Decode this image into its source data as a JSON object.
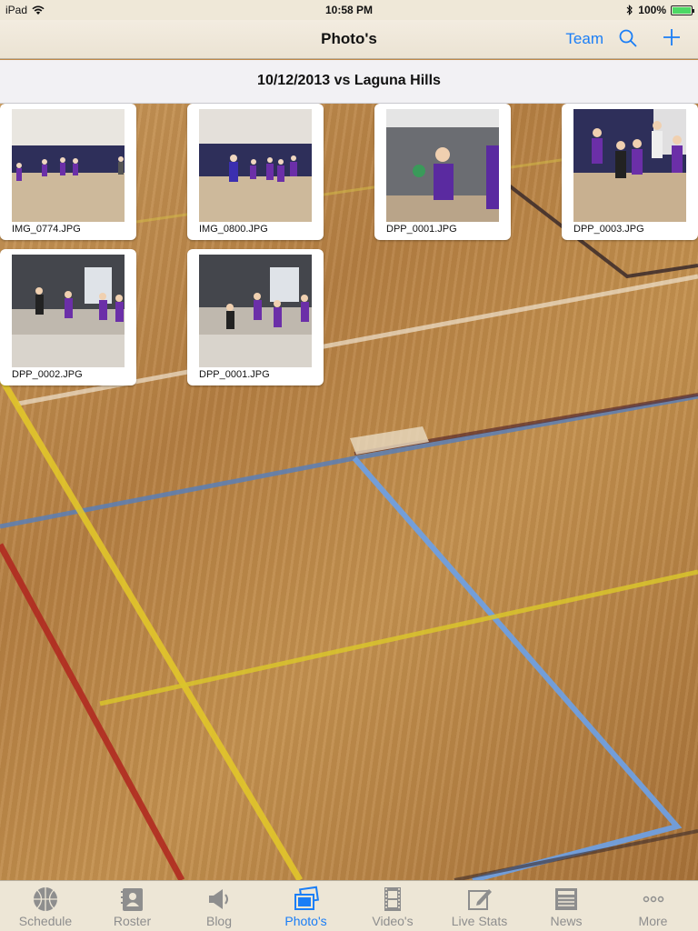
{
  "status_bar": {
    "device": "iPad",
    "time": "10:58 PM",
    "battery": "100%",
    "battery_level": 1.0
  },
  "nav": {
    "title": "Photo's",
    "team_label": "Team"
  },
  "game": {
    "title": "10/12/2013 vs Laguna Hills"
  },
  "photos": [
    {
      "name": "IMG_0774.JPG"
    },
    {
      "name": "IMG_0800.JPG"
    },
    {
      "name": "DPP_0001.JPG"
    },
    {
      "name": "DPP_0003.JPG"
    },
    {
      "name": "DPP_0002.JPG"
    },
    {
      "name": "DPP_0001.JPG"
    }
  ],
  "tabs": [
    {
      "label": "Schedule",
      "icon": "basketball-icon"
    },
    {
      "label": "Roster",
      "icon": "roster-icon"
    },
    {
      "label": "Blog",
      "icon": "megaphone-icon"
    },
    {
      "label": "Photo's",
      "icon": "photos-icon",
      "active": true
    },
    {
      "label": "Video's",
      "icon": "film-icon"
    },
    {
      "label": "Live Stats",
      "icon": "edit-icon"
    },
    {
      "label": "News",
      "icon": "newspaper-icon"
    },
    {
      "label": "More",
      "icon": "more-icon"
    }
  ],
  "colors": {
    "accent": "#1a7ef6",
    "tab_inactive": "#8e8e8e"
  }
}
